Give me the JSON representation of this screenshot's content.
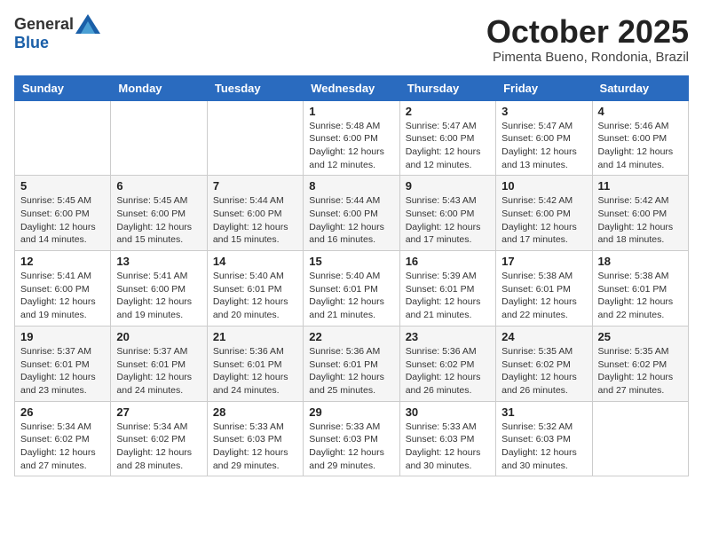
{
  "header": {
    "logo_general": "General",
    "logo_blue": "Blue",
    "month": "October 2025",
    "location": "Pimenta Bueno, Rondonia, Brazil"
  },
  "weekdays": [
    "Sunday",
    "Monday",
    "Tuesday",
    "Wednesday",
    "Thursday",
    "Friday",
    "Saturday"
  ],
  "weeks": [
    [
      {
        "day": "",
        "info": ""
      },
      {
        "day": "",
        "info": ""
      },
      {
        "day": "",
        "info": ""
      },
      {
        "day": "1",
        "info": "Sunrise: 5:48 AM\nSunset: 6:00 PM\nDaylight: 12 hours and 12 minutes."
      },
      {
        "day": "2",
        "info": "Sunrise: 5:47 AM\nSunset: 6:00 PM\nDaylight: 12 hours and 12 minutes."
      },
      {
        "day": "3",
        "info": "Sunrise: 5:47 AM\nSunset: 6:00 PM\nDaylight: 12 hours and 13 minutes."
      },
      {
        "day": "4",
        "info": "Sunrise: 5:46 AM\nSunset: 6:00 PM\nDaylight: 12 hours and 14 minutes."
      }
    ],
    [
      {
        "day": "5",
        "info": "Sunrise: 5:45 AM\nSunset: 6:00 PM\nDaylight: 12 hours and 14 minutes."
      },
      {
        "day": "6",
        "info": "Sunrise: 5:45 AM\nSunset: 6:00 PM\nDaylight: 12 hours and 15 minutes."
      },
      {
        "day": "7",
        "info": "Sunrise: 5:44 AM\nSunset: 6:00 PM\nDaylight: 12 hours and 15 minutes."
      },
      {
        "day": "8",
        "info": "Sunrise: 5:44 AM\nSunset: 6:00 PM\nDaylight: 12 hours and 16 minutes."
      },
      {
        "day": "9",
        "info": "Sunrise: 5:43 AM\nSunset: 6:00 PM\nDaylight: 12 hours and 17 minutes."
      },
      {
        "day": "10",
        "info": "Sunrise: 5:42 AM\nSunset: 6:00 PM\nDaylight: 12 hours and 17 minutes."
      },
      {
        "day": "11",
        "info": "Sunrise: 5:42 AM\nSunset: 6:00 PM\nDaylight: 12 hours and 18 minutes."
      }
    ],
    [
      {
        "day": "12",
        "info": "Sunrise: 5:41 AM\nSunset: 6:00 PM\nDaylight: 12 hours and 19 minutes."
      },
      {
        "day": "13",
        "info": "Sunrise: 5:41 AM\nSunset: 6:00 PM\nDaylight: 12 hours and 19 minutes."
      },
      {
        "day": "14",
        "info": "Sunrise: 5:40 AM\nSunset: 6:01 PM\nDaylight: 12 hours and 20 minutes."
      },
      {
        "day": "15",
        "info": "Sunrise: 5:40 AM\nSunset: 6:01 PM\nDaylight: 12 hours and 21 minutes."
      },
      {
        "day": "16",
        "info": "Sunrise: 5:39 AM\nSunset: 6:01 PM\nDaylight: 12 hours and 21 minutes."
      },
      {
        "day": "17",
        "info": "Sunrise: 5:38 AM\nSunset: 6:01 PM\nDaylight: 12 hours and 22 minutes."
      },
      {
        "day": "18",
        "info": "Sunrise: 5:38 AM\nSunset: 6:01 PM\nDaylight: 12 hours and 22 minutes."
      }
    ],
    [
      {
        "day": "19",
        "info": "Sunrise: 5:37 AM\nSunset: 6:01 PM\nDaylight: 12 hours and 23 minutes."
      },
      {
        "day": "20",
        "info": "Sunrise: 5:37 AM\nSunset: 6:01 PM\nDaylight: 12 hours and 24 minutes."
      },
      {
        "day": "21",
        "info": "Sunrise: 5:36 AM\nSunset: 6:01 PM\nDaylight: 12 hours and 24 minutes."
      },
      {
        "day": "22",
        "info": "Sunrise: 5:36 AM\nSunset: 6:01 PM\nDaylight: 12 hours and 25 minutes."
      },
      {
        "day": "23",
        "info": "Sunrise: 5:36 AM\nSunset: 6:02 PM\nDaylight: 12 hours and 26 minutes."
      },
      {
        "day": "24",
        "info": "Sunrise: 5:35 AM\nSunset: 6:02 PM\nDaylight: 12 hours and 26 minutes."
      },
      {
        "day": "25",
        "info": "Sunrise: 5:35 AM\nSunset: 6:02 PM\nDaylight: 12 hours and 27 minutes."
      }
    ],
    [
      {
        "day": "26",
        "info": "Sunrise: 5:34 AM\nSunset: 6:02 PM\nDaylight: 12 hours and 27 minutes."
      },
      {
        "day": "27",
        "info": "Sunrise: 5:34 AM\nSunset: 6:02 PM\nDaylight: 12 hours and 28 minutes."
      },
      {
        "day": "28",
        "info": "Sunrise: 5:33 AM\nSunset: 6:03 PM\nDaylight: 12 hours and 29 minutes."
      },
      {
        "day": "29",
        "info": "Sunrise: 5:33 AM\nSunset: 6:03 PM\nDaylight: 12 hours and 29 minutes."
      },
      {
        "day": "30",
        "info": "Sunrise: 5:33 AM\nSunset: 6:03 PM\nDaylight: 12 hours and 30 minutes."
      },
      {
        "day": "31",
        "info": "Sunrise: 5:32 AM\nSunset: 6:03 PM\nDaylight: 12 hours and 30 minutes."
      },
      {
        "day": "",
        "info": ""
      }
    ]
  ]
}
